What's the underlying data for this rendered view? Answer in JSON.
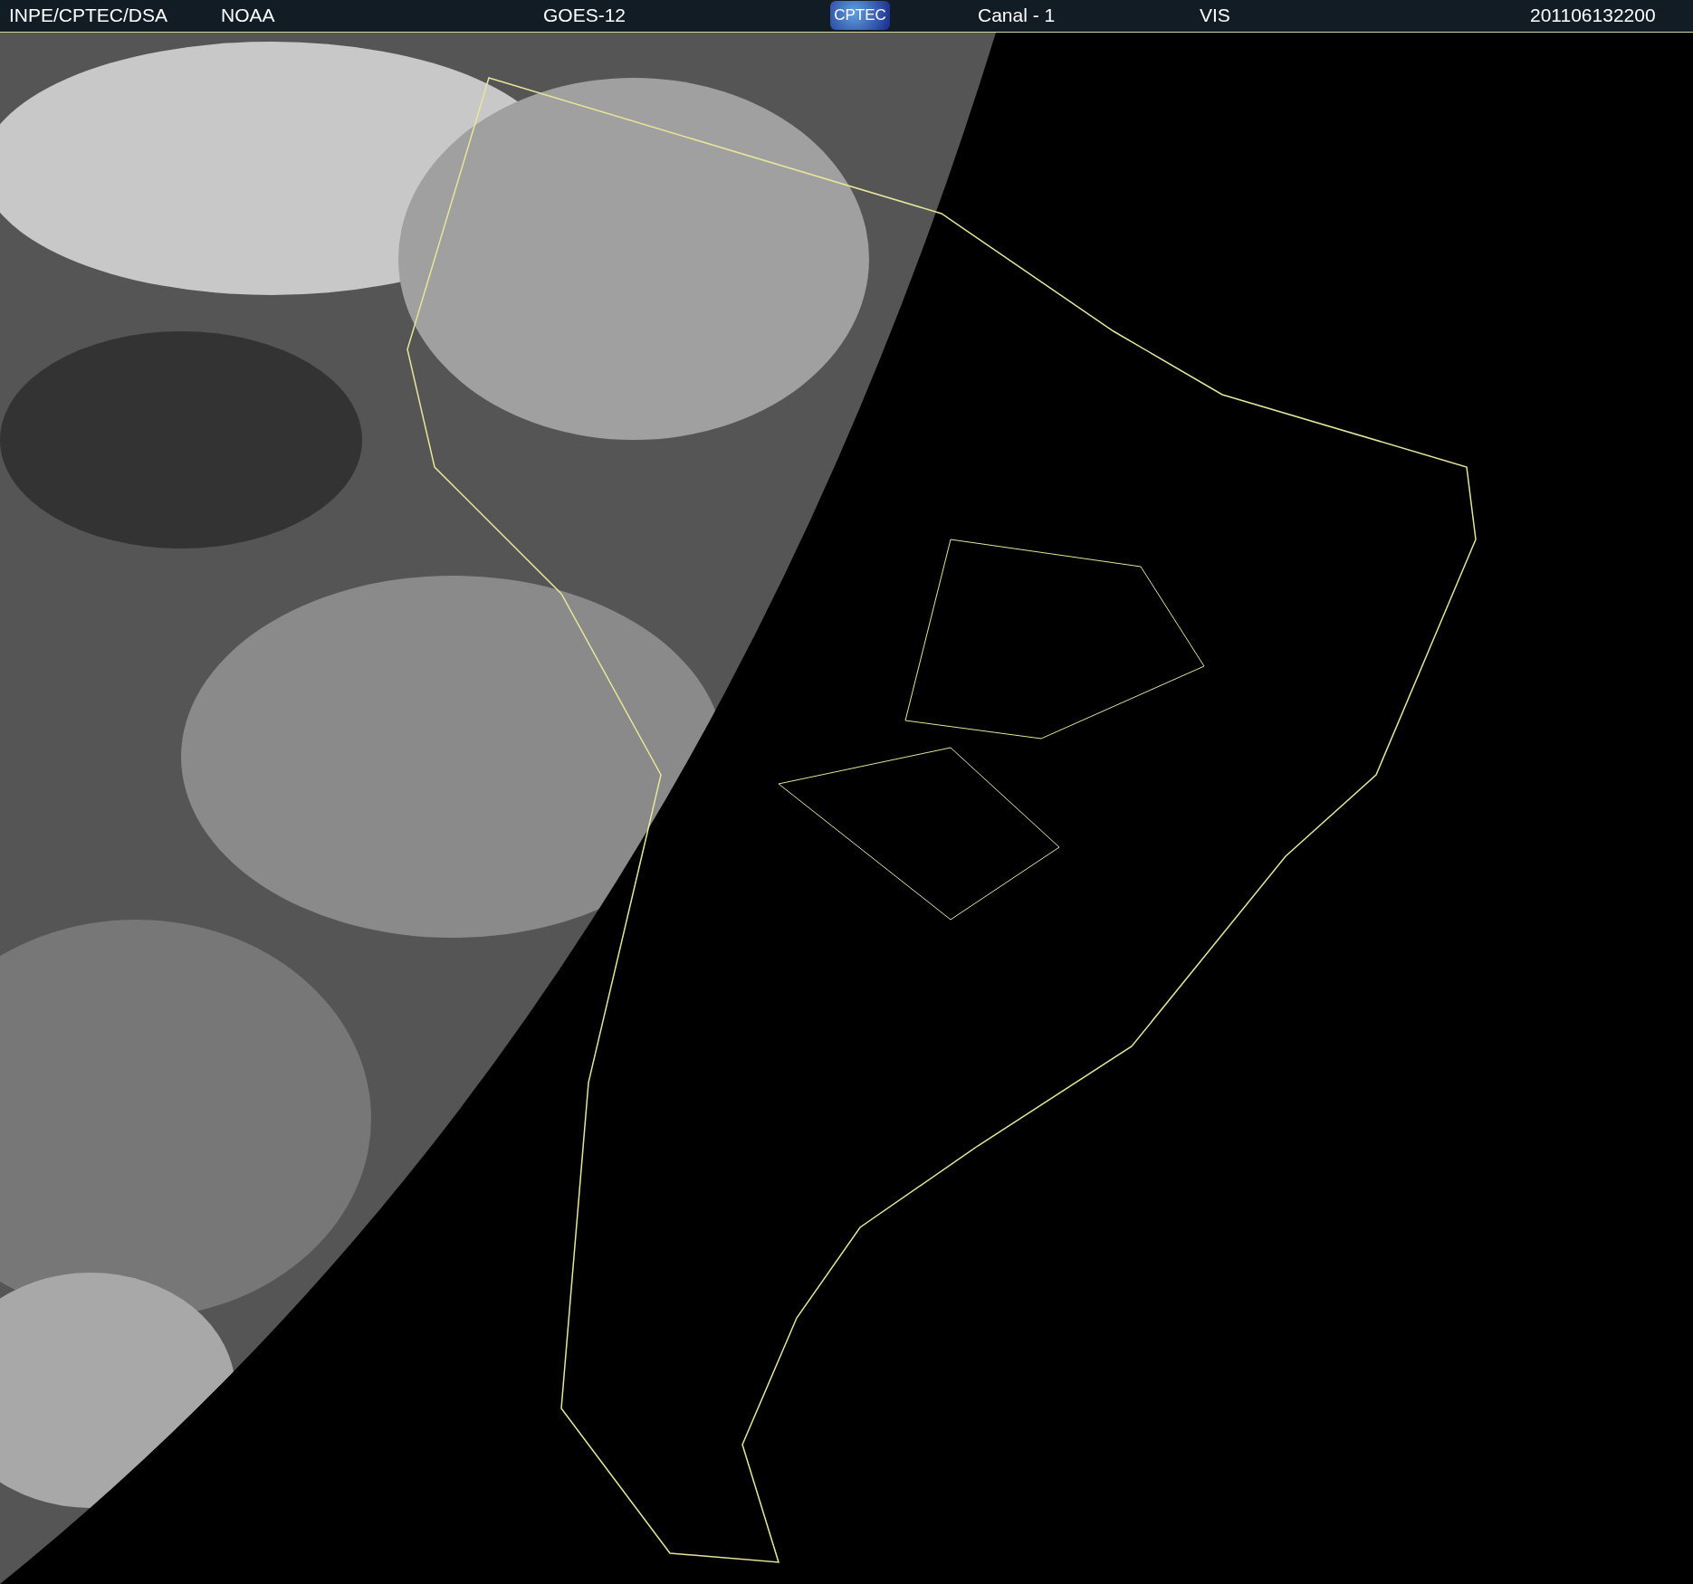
{
  "header": {
    "items": [
      {
        "kind": "text",
        "text": "INPE/CPTEC/DSA"
      },
      {
        "kind": "text",
        "text": "NOAA"
      },
      {
        "kind": "text",
        "text": "GOES-12"
      },
      {
        "kind": "logo",
        "text": "CPTEC"
      },
      {
        "kind": "text",
        "text": "Canal - 1"
      },
      {
        "kind": "text",
        "text": "VIS"
      },
      {
        "kind": "text",
        "text": "201106132200"
      }
    ]
  }
}
